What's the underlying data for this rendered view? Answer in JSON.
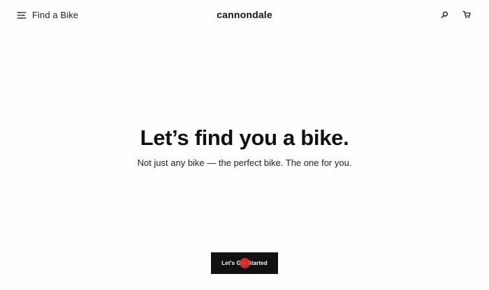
{
  "header": {
    "menu_label": "Find a Bike",
    "brand": "cannondale"
  },
  "hero": {
    "title": "Let’s find you a bike.",
    "subtitle": "Not just any bike — the perfect bike. The one for you."
  },
  "cta": {
    "label": "Let's Get Started"
  },
  "icons": {
    "menu": "menu-icon",
    "search": "search-icon",
    "cart": "cart-icon"
  },
  "colors": {
    "background": "#fefefe",
    "text": "#111111",
    "button_bg": "#111111",
    "button_text": "#ffffff",
    "click_marker": "#e03131"
  }
}
